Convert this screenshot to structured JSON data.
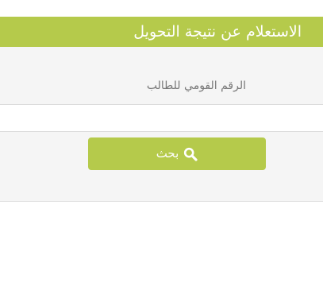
{
  "panel": {
    "title": "الاستعلام عن نتيجة التحويل"
  },
  "form": {
    "national_id_label": "الرقم القومي للطالب",
    "national_id_value": "",
    "search_button_label": "بحث",
    "search_icon": "search-icon"
  },
  "colors": {
    "accent": "#b5ca4b",
    "panel_background": "#f5f5f5",
    "label_text": "#777777"
  }
}
